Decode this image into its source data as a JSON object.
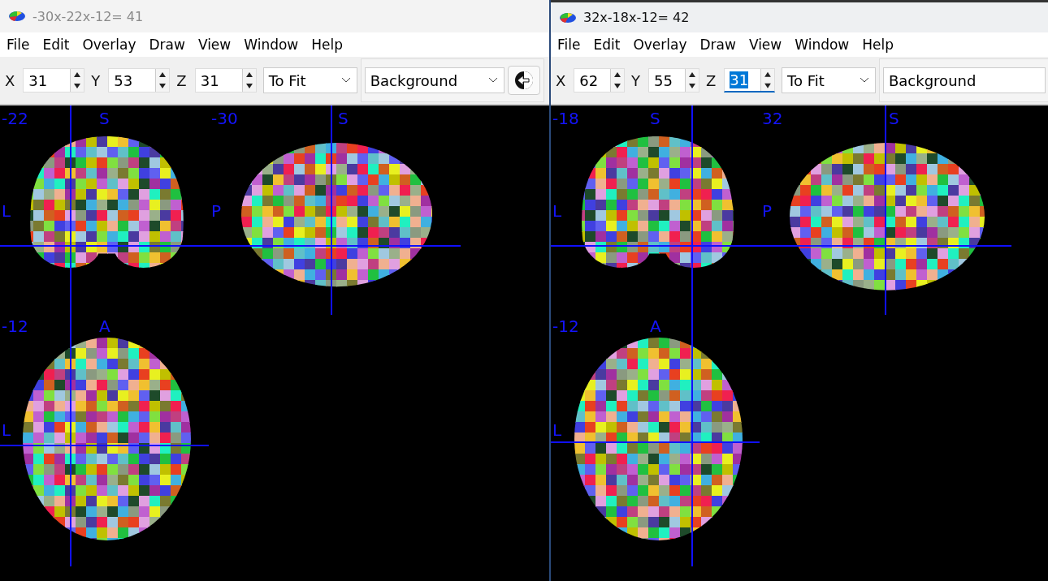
{
  "windows": [
    {
      "title": "-30x-22x-12= 41",
      "active": false,
      "menu": [
        "File",
        "Edit",
        "Overlay",
        "Draw",
        "View",
        "Window",
        "Help"
      ],
      "coords": [
        {
          "label": "X",
          "value": "31",
          "focused": false
        },
        {
          "label": "Y",
          "value": "53",
          "focused": false
        },
        {
          "label": "Z",
          "value": "31",
          "focused": false
        }
      ],
      "zoom": "To Fit",
      "layer": "Background",
      "back_button": true,
      "views": [
        {
          "kind": "coronal",
          "coordinate": "-22",
          "top_label": "S",
          "side_label": "L"
        },
        {
          "kind": "sagittal",
          "coordinate": "-30",
          "top_label": "S",
          "side_label": "P"
        },
        {
          "kind": "axial",
          "coordinate": "-12",
          "top_label": "A",
          "side_label": "L"
        }
      ]
    },
    {
      "title": "32x-18x-12= 42",
      "active": true,
      "menu": [
        "File",
        "Edit",
        "Overlay",
        "Draw",
        "View",
        "Window",
        "Help"
      ],
      "coords": [
        {
          "label": "X",
          "value": "62",
          "focused": false
        },
        {
          "label": "Y",
          "value": "55",
          "focused": false
        },
        {
          "label": "Z",
          "value": "31",
          "focused": true
        }
      ],
      "zoom": "To Fit",
      "layer": "Background",
      "back_button": false,
      "views": [
        {
          "kind": "coronal",
          "coordinate": "-18",
          "top_label": "S",
          "side_label": "L"
        },
        {
          "kind": "sagittal",
          "coordinate": "32",
          "top_label": "S",
          "side_label": "P"
        },
        {
          "kind": "axial",
          "coordinate": "-12",
          "top_label": "A",
          "side_label": "L"
        }
      ]
    }
  ]
}
